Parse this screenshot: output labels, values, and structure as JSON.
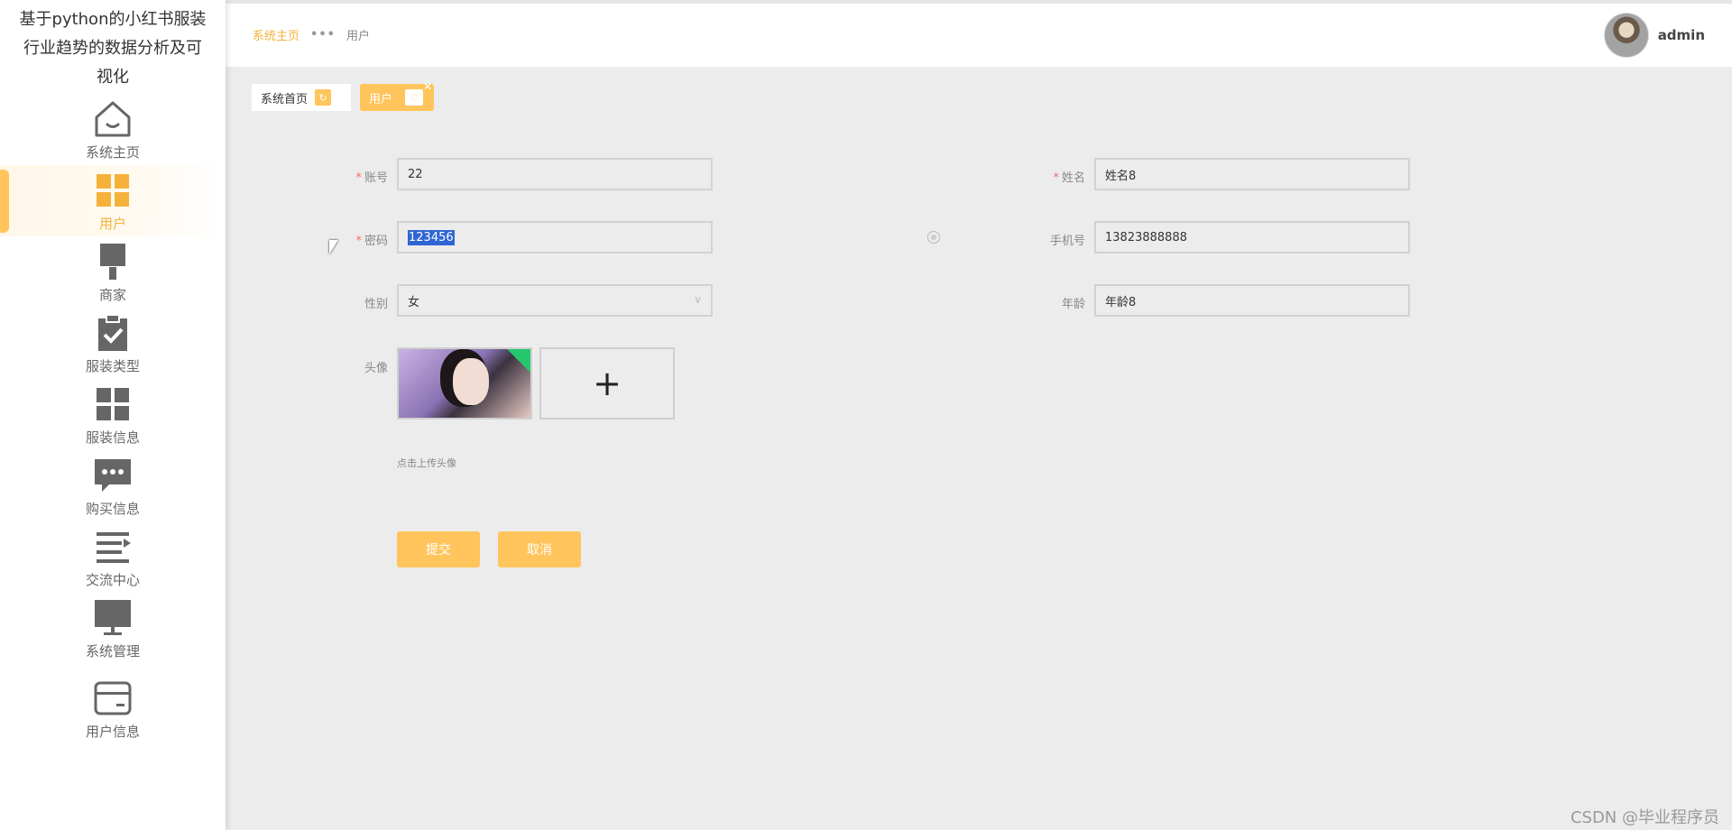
{
  "app": {
    "title": "基于python的小红书服装行业趋势的数据分析及可视化"
  },
  "sidebar": {
    "items": [
      {
        "label": "系统主页",
        "icon": "home-icon"
      },
      {
        "label": "用户",
        "icon": "grid-icon",
        "active": true
      },
      {
        "label": "商家",
        "icon": "brush-icon"
      },
      {
        "label": "服装类型",
        "icon": "clipboard-check-icon"
      },
      {
        "label": "服装信息",
        "icon": "grid-icon"
      },
      {
        "label": "购买信息",
        "icon": "chat-icon"
      },
      {
        "label": "交流中心",
        "icon": "list-icon"
      },
      {
        "label": "系统管理",
        "icon": "monitor-icon"
      },
      {
        "label": "用户信息",
        "icon": "card-icon"
      }
    ]
  },
  "header": {
    "breadcrumb": {
      "home": "系统主页",
      "separator": "•••",
      "current": "用户"
    },
    "username": "admin"
  },
  "tabs": [
    {
      "label": "系统首页"
    },
    {
      "label": "用户"
    }
  ],
  "form": {
    "account": {
      "label": "账号",
      "value": "22"
    },
    "name": {
      "label": "姓名",
      "value": "姓名8"
    },
    "password": {
      "label": "密码",
      "value": "123456"
    },
    "phone": {
      "label": "手机号",
      "value": "13823888888"
    },
    "gender": {
      "label": "性别",
      "value": "女"
    },
    "age": {
      "label": "年龄",
      "value": "年龄8"
    },
    "avatar": {
      "label": "头像",
      "hint": "点击上传头像"
    },
    "submit_label": "提交",
    "cancel_label": "取消"
  },
  "watermark": "CSDN @毕业程序员",
  "colors": {
    "accent": "#ffc55c",
    "accent_text": "#f5b23b",
    "required": "#f56c6c",
    "selection": "#2f66d3"
  }
}
